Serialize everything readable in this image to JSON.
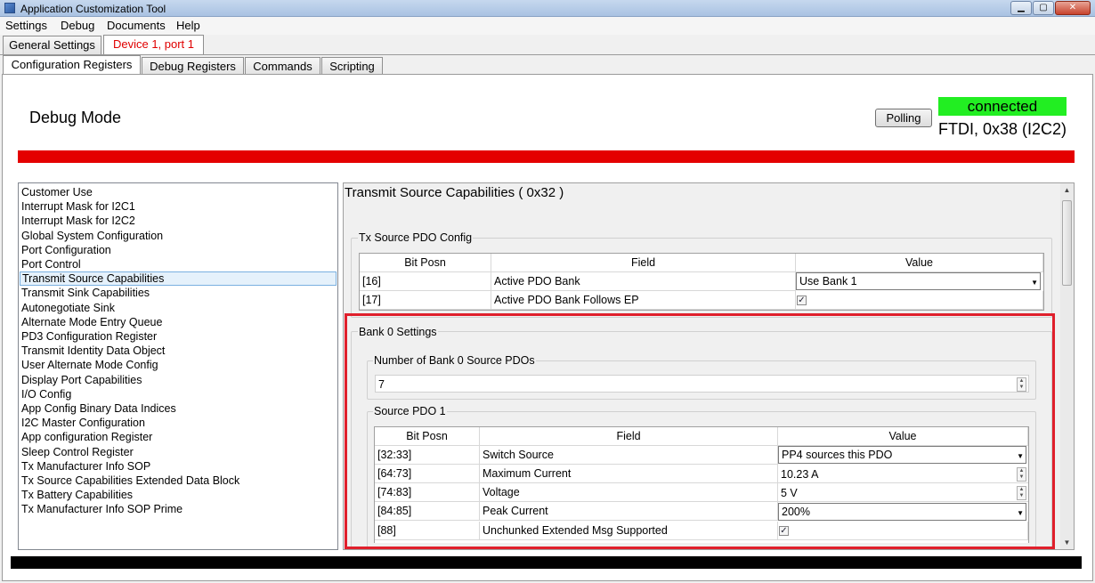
{
  "window": {
    "title": "Application Customization Tool"
  },
  "menu": [
    "Settings",
    "Debug",
    "Documents",
    "Help"
  ],
  "device_tabs": [
    {
      "label": "General Settings"
    },
    {
      "label": "Device 1, port 1"
    }
  ],
  "sub_tabs": [
    {
      "label": "Configuration Registers"
    },
    {
      "label": "Debug Registers"
    },
    {
      "label": "Commands"
    },
    {
      "label": "Scripting"
    }
  ],
  "header": {
    "mode": "Debug Mode",
    "polling_label": "Polling",
    "status": "connected",
    "connection": "FTDI, 0x38 (I2C2)",
    "status_color": "#22ee22",
    "bar_color": "#e40000"
  },
  "register_list": {
    "selected": "Transmit Source Capabilities",
    "items": [
      "Customer Use",
      "Interrupt Mask for I2C1",
      "Interrupt Mask for I2C2",
      "Global System Configuration",
      "Port Configuration",
      "Port Control",
      "Transmit Source Capabilities",
      "Transmit Sink Capabilities",
      "Autonegotiate Sink",
      "Alternate Mode Entry Queue",
      "PD3 Configuration Register",
      "Transmit Identity Data Object",
      "User Alternate Mode Config",
      "Display Port Capabilities",
      "I/O Config",
      "App Config Binary Data Indices",
      "I2C Master Configuration",
      "App configuration Register",
      "Sleep Control Register",
      "Tx Manufacturer Info SOP",
      "Tx Source Capabilities Extended Data Block",
      "Tx Battery Capabilities",
      "Tx Manufacturer Info SOP Prime"
    ]
  },
  "detail": {
    "title": "Transmit Source Capabilities  ( 0x32 )",
    "pdo_config": {
      "group_label": "Tx Source PDO Config",
      "columns": [
        "Bit Posn",
        "Field",
        "Value"
      ],
      "rows": [
        {
          "bit": "[16]",
          "field": "Active PDO Bank",
          "value": "Use Bank 1",
          "kind": "combo"
        },
        {
          "bit": "[17]",
          "field": "Active PDO Bank Follows EP",
          "value": "✓",
          "kind": "check"
        }
      ]
    },
    "bank0": {
      "group_label": "Bank 0 Settings",
      "num_pdos_label": "Number of Bank 0 Source PDOs",
      "num_pdos_value": "7",
      "pdo1": {
        "group_label": "Source PDO 1",
        "columns": [
          "Bit Posn",
          "Field",
          "Value"
        ],
        "rows": [
          {
            "bit": "[32:33]",
            "field": "Switch Source",
            "value": "PP4 sources this PDO",
            "kind": "combo"
          },
          {
            "bit": "[64:73]",
            "field": "Maximum Current",
            "value": "10.23 A",
            "kind": "spin"
          },
          {
            "bit": "[74:83]",
            "field": "Voltage",
            "value": "5 V",
            "kind": "spin"
          },
          {
            "bit": "[84:85]",
            "field": "Peak Current",
            "value": "200%",
            "kind": "combo"
          },
          {
            "bit": "[88]",
            "field": "Unchunked Extended Msg Supported",
            "value": "✓",
            "kind": "check"
          }
        ]
      }
    }
  }
}
